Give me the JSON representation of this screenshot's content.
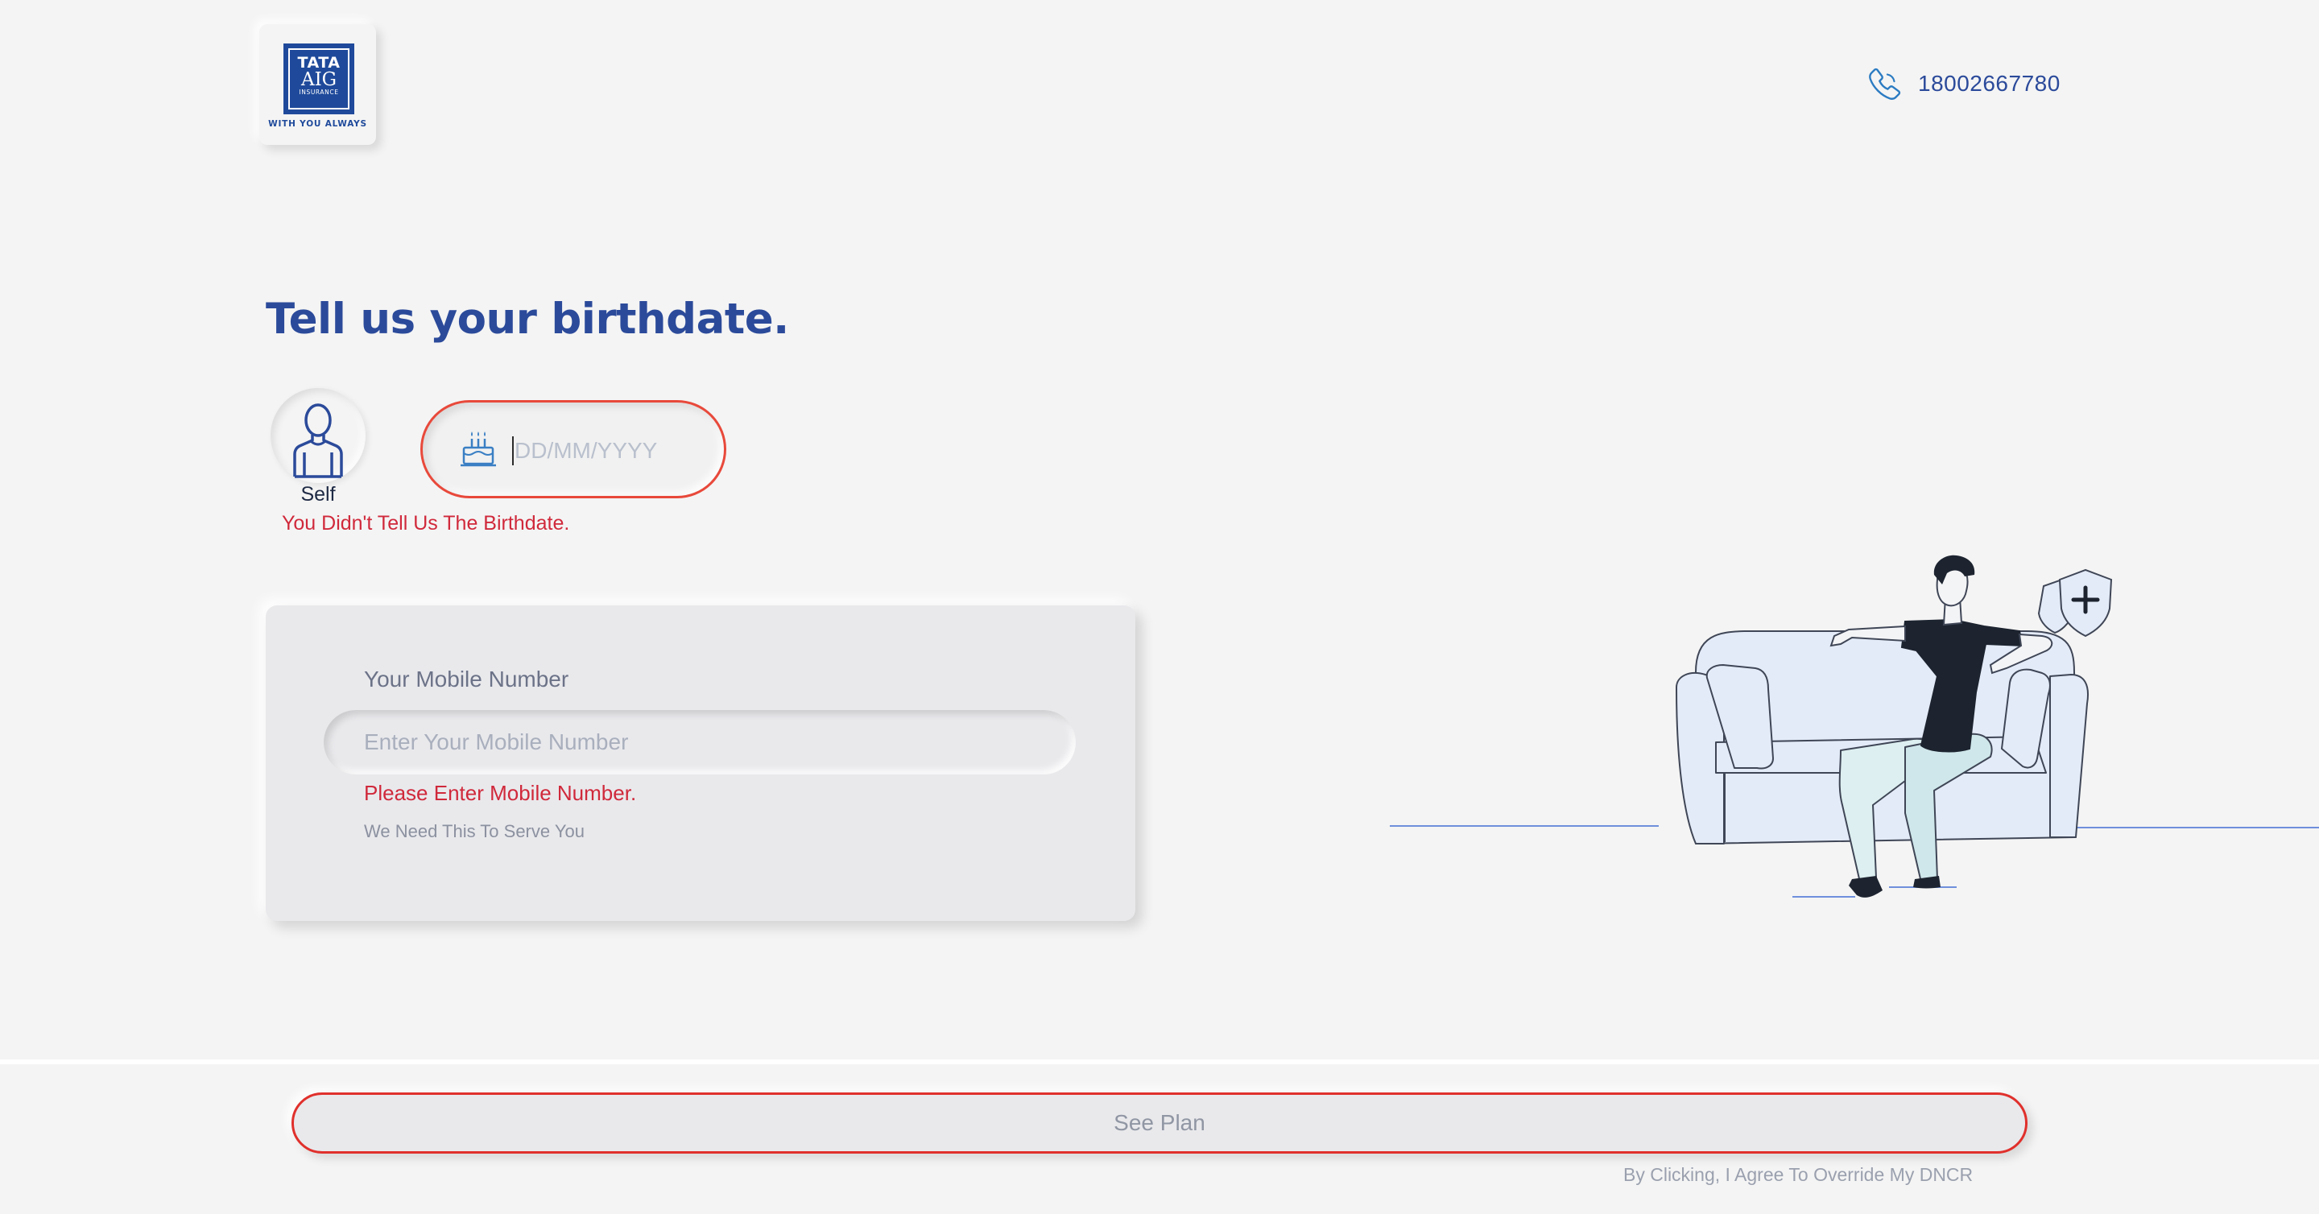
{
  "header": {
    "logo": {
      "brand": "TATA",
      "sub_brand": "AIG",
      "product": "INSURANCE",
      "tagline": "WITH YOU ALWAYS"
    },
    "phone_number": "18002667780"
  },
  "main": {
    "title": "Tell us your birthdate.",
    "member": {
      "label": "Self"
    },
    "birthdate": {
      "placeholder": "DD/MM/YYYY",
      "value": "",
      "error": "You Didn't Tell Us The Birthdate."
    },
    "mobile": {
      "label": "Your Mobile Number",
      "placeholder": "Enter Your Mobile Number",
      "value": "",
      "error": "Please Enter Mobile Number.",
      "hint": "We Need This To Serve You"
    }
  },
  "footer": {
    "cta_label": "See Plan",
    "disclaimer": "By Clicking, I Agree To Override My DNCR"
  },
  "icons": {
    "phone": "phone-icon",
    "cake": "birthday-cake-icon",
    "avatar": "person-avatar-icon",
    "shield": "shield-plus-icon"
  },
  "colors": {
    "primary": "#2b4a9a",
    "error": "#d0293b",
    "error_border": "#e0302c",
    "background": "#f4f4f4",
    "card": "#e9e9ec"
  }
}
